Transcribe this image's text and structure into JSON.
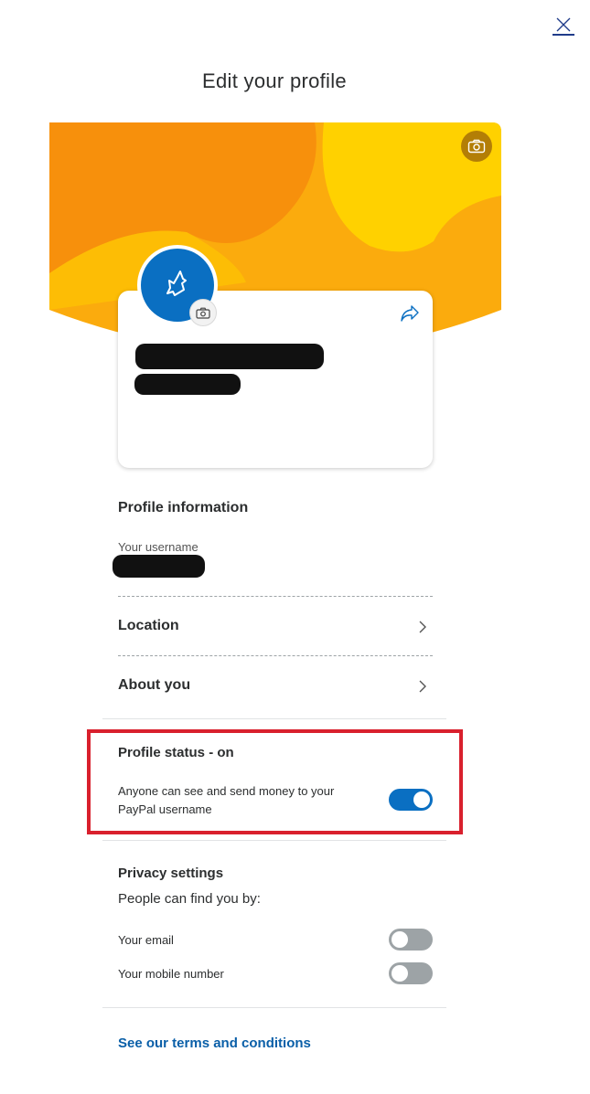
{
  "window": {
    "close_icon": "close-icon"
  },
  "header": {
    "title": "Edit your profile"
  },
  "banner": {
    "colors": {
      "base": "#fbab0d",
      "dark": "#f7900c",
      "light": "#ffd100"
    },
    "camera_icon": "camera-icon"
  },
  "profile_card": {
    "avatar_icon": "paypal-bird-icon",
    "avatar_color": "#0a6fc2",
    "avatar_camera_icon": "camera-icon",
    "share_icon": "share-icon",
    "name_redacted": true,
    "handle_redacted": true
  },
  "profile_information": {
    "heading": "Profile information",
    "username_label": "Your username",
    "username_redacted": true,
    "rows": [
      {
        "label": "Location"
      },
      {
        "label": "About you"
      }
    ]
  },
  "profile_status": {
    "heading": "Profile status - on",
    "description": "Anyone can see and send money to your PayPal username",
    "toggle_on": true,
    "highlight_color": "#d9202d"
  },
  "privacy": {
    "heading": "Privacy settings",
    "subheading": "People can find you by:",
    "options": [
      {
        "label": "Your email",
        "on": false
      },
      {
        "label": "Your mobile number",
        "on": false
      }
    ]
  },
  "footer": {
    "terms_link": "See our terms and conditions"
  },
  "colors": {
    "accent": "#0a6fc2",
    "link": "#0a5fa8",
    "toggle_off": "#9da3a6"
  }
}
